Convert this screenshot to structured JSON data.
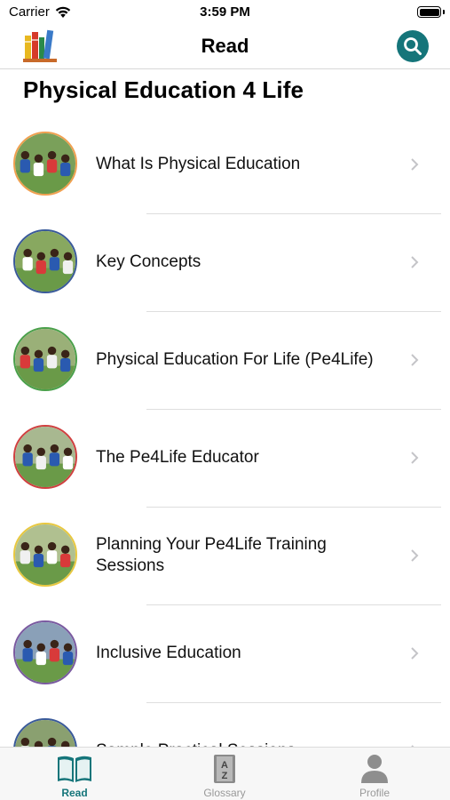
{
  "status_bar": {
    "carrier": "Carrier",
    "time": "3:59 PM"
  },
  "nav": {
    "title": "Read",
    "logo_icon": "books-icon",
    "search_icon": "search-icon"
  },
  "section": {
    "title": "Physical Education 4 Life"
  },
  "list": {
    "items": [
      {
        "label": "What Is Physical Education",
        "ring": "#f0a050",
        "bg": "#7aa05a"
      },
      {
        "label": "Key Concepts",
        "ring": "#3a5a9a",
        "bg": "#88a860"
      },
      {
        "label": "Physical Education For Life (Pe4Life)",
        "ring": "#4aa04a",
        "bg": "#9ab078"
      },
      {
        "label": "The Pe4Life Educator",
        "ring": "#d04040",
        "bg": "#a8b890"
      },
      {
        "label": "Planning Your Pe4Life Training Sessions",
        "ring": "#e8c840",
        "bg": "#b0c090"
      },
      {
        "label": "Inclusive Education",
        "ring": "#7a5aa0",
        "bg": "#8aa0b8"
      },
      {
        "label": "Sample Practical Sessions",
        "ring": "#3a5a9a",
        "bg": "#8aa070"
      }
    ]
  },
  "tab_bar": {
    "tabs": [
      {
        "label": "Read",
        "icon": "book-open-icon",
        "active": true
      },
      {
        "label": "Glossary",
        "icon": "glossary-icon",
        "active": false
      },
      {
        "label": "Profile",
        "icon": "person-icon",
        "active": false
      }
    ]
  },
  "colors": {
    "accent": "#15757a"
  }
}
